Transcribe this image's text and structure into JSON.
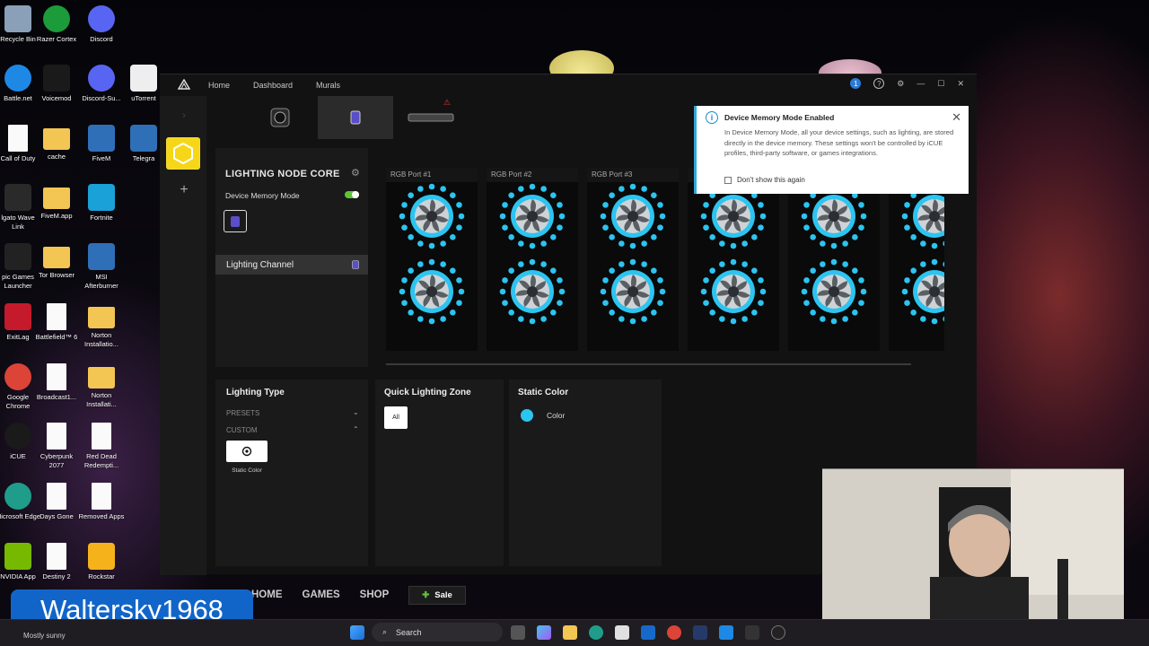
{
  "desktop": {
    "icons": [
      {
        "label": "Recycle Bin",
        "icon": "recycle-bin-icon",
        "color": "#8aa0b8"
      },
      {
        "label": "Razer Cortex",
        "icon": "razer-cortex-icon",
        "color": "#1c9b3a"
      },
      {
        "label": "Discord",
        "icon": "discord-icon",
        "color": "#5865f2"
      },
      {
        "label": "Battle.net",
        "icon": "battlenet-icon",
        "color": "#1e88e5"
      },
      {
        "label": "Voicemod",
        "icon": "voicemod-icon",
        "color": "#1a1a1a"
      },
      {
        "label": "Discord-Su...",
        "icon": "discord-icon",
        "color": "#5865f2"
      },
      {
        "label": "uTorrent",
        "icon": "utorrent-icon",
        "color": "#eeeeee"
      },
      {
        "label": "Call of Duty",
        "icon": "file-icon",
        "color": "#fafafa"
      },
      {
        "label": "cache",
        "icon": "folder-icon",
        "color": "#f3c552"
      },
      {
        "label": "FiveM",
        "icon": "fivem-icon",
        "color": "#2f6fb8"
      },
      {
        "label": "Telegra",
        "icon": "telegram-icon",
        "color": "#2f6fb8"
      },
      {
        "label": "lgato Wave Link",
        "icon": "wave-link-icon",
        "color": "#2a2a2a"
      },
      {
        "label": "FiveM.app",
        "icon": "folder-icon",
        "color": "#f3c552"
      },
      {
        "label": "Fortnite",
        "icon": "fortnite-icon",
        "color": "#1aa1d8"
      },
      {
        "label": "pic Games Launcher",
        "icon": "epic-games-icon",
        "color": "#222222"
      },
      {
        "label": "Tor Browser",
        "icon": "folder-icon",
        "color": "#f3c552"
      },
      {
        "label": "MSI Afterburner",
        "icon": "msi-icon",
        "color": "#2f6fb8"
      },
      {
        "label": "ExitLag",
        "icon": "exitlag-icon",
        "color": "#c41a2b"
      },
      {
        "label": "Battlefield™ 6",
        "icon": "file-icon",
        "color": "#fafafa"
      },
      {
        "label": "Norton Installatio...",
        "icon": "folder-icon",
        "color": "#f3c552"
      },
      {
        "label": "Google Chrome",
        "icon": "chrome-icon",
        "color": "#db4437"
      },
      {
        "label": "Broadcast1...",
        "icon": "file-icon",
        "color": "#fafafa"
      },
      {
        "label": "Norton Installati...",
        "icon": "folder-icon",
        "color": "#f3c552"
      },
      {
        "label": "iCUE",
        "icon": "icue-icon",
        "color": "#1a1a1a"
      },
      {
        "label": "Cyberpunk 2077",
        "icon": "file-icon",
        "color": "#fafafa"
      },
      {
        "label": "Red Dead Redempti...",
        "icon": "file-icon",
        "color": "#fafafa"
      },
      {
        "label": "Microsoft Edge",
        "icon": "edge-icon",
        "color": "#1f9d8a"
      },
      {
        "label": "Days Gone",
        "icon": "file-icon",
        "color": "#fafafa"
      },
      {
        "label": "Removed Apps",
        "icon": "file-icon",
        "color": "#fafafa"
      },
      {
        "label": "NVIDIA App",
        "icon": "nvidia-icon",
        "color": "#76b900"
      },
      {
        "label": "Destiny 2",
        "icon": "file-icon",
        "color": "#fafafa"
      },
      {
        "label": "Rockstar",
        "icon": "rockstar-icon",
        "color": "#f6b21a"
      }
    ]
  },
  "app": {
    "nav": [
      "Home",
      "Dashboard",
      "Murals"
    ],
    "notification_count": "1",
    "device_title": "LIGHTING NODE CORE",
    "device_memory_label": "Device Memory Mode",
    "device_memory_on": true,
    "channel_label": "Lighting Channel",
    "ports": [
      "RGB Port #1",
      "RGB Port #2",
      "RGB Port #3",
      "",
      "",
      ""
    ],
    "fan_color": "#2cc4f0",
    "lighting_type": {
      "title": "Lighting Type",
      "presets": "PRESETS",
      "custom": "CUSTOM",
      "effect_label": "Static Color"
    },
    "quick_zone": {
      "title": "Quick Lighting Zone",
      "all_label": "All"
    },
    "static_color": {
      "title": "Static Color",
      "color_label": "Color",
      "swatch": "#2cc4f0"
    },
    "toast": {
      "title": "Device Memory Mode Enabled",
      "body": "In Device Memory Mode, all your device settings, such as lighting, are stored directly in the device memory. These settings won't be controlled by iCUE profiles, third-party software, or games integrations.",
      "checkbox": "Don't show this again"
    },
    "store": {
      "home": "HOME",
      "games": "GAMES",
      "shop": "SHOP",
      "sale": "Sale"
    }
  },
  "overlay": {
    "watermark": "Waltersky1968"
  },
  "taskbar": {
    "search": "Search",
    "weather": "Mostly sunny"
  }
}
